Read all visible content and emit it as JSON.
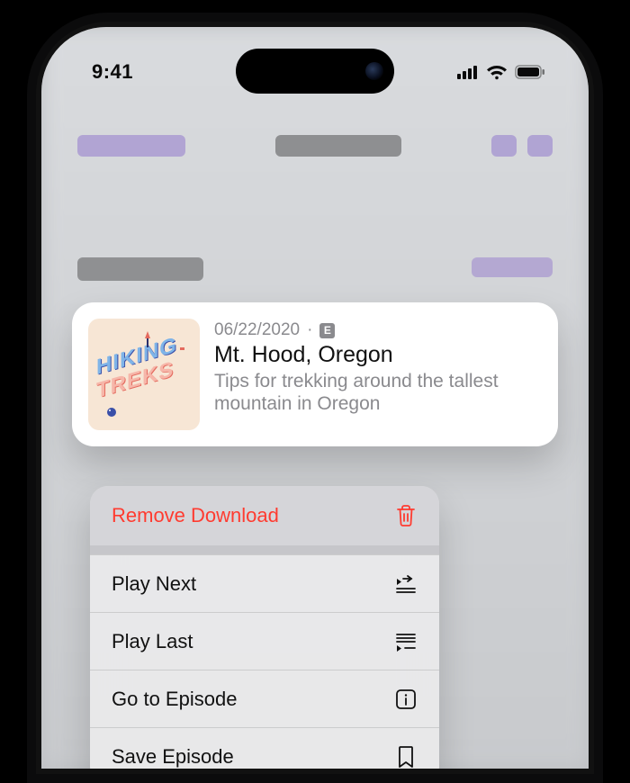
{
  "status": {
    "time": "9:41"
  },
  "card": {
    "date": "06/22/2020",
    "explicit_glyph": "E",
    "title": "Mt. Hood, Oregon",
    "description": "Tips for trekking around the tallest mountain in Oregon",
    "artwork_text_1": "HIKING",
    "artwork_text_2": "TREKS"
  },
  "menu": {
    "remove_download": "Remove Download",
    "play_next": "Play Next",
    "play_last": "Play Last",
    "go_to_episode": "Go to Episode",
    "save_episode": "Save Episode"
  }
}
